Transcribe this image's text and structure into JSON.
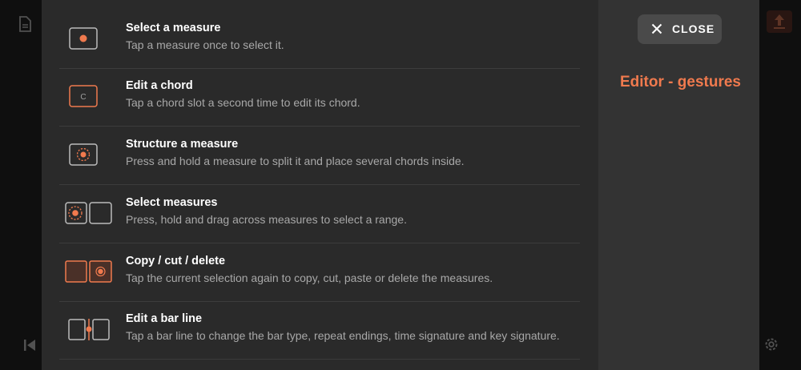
{
  "panel": {
    "title": "Editor - gestures",
    "close_label": "CLOSE"
  },
  "gestures": [
    {
      "icon": "select-measure-icon",
      "title": "Select a measure",
      "description": "Tap a measure once to select it."
    },
    {
      "icon": "edit-chord-icon",
      "title": "Edit a chord",
      "description": "Tap a chord slot a second time to edit its chord."
    },
    {
      "icon": "structure-measure-icon",
      "title": "Structure a measure",
      "description": "Press and hold a measure to split it and place several chords inside."
    },
    {
      "icon": "select-measures-icon",
      "title": "Select measures",
      "description": "Press, hold and drag across measures to select a range."
    },
    {
      "icon": "copy-cut-delete-icon",
      "title": "Copy / cut / delete",
      "description": "Tap the current selection again to copy, cut, paste or delete the measures."
    },
    {
      "icon": "edit-bar-line-icon",
      "title": "Edit a bar line",
      "description": "Tap a bar line to change the bar type, repeat endings, time signature and key signature."
    }
  ],
  "chord_glyph": "C",
  "colors": {
    "accent": "#f07a4e",
    "panel": "#2a2a2a",
    "sidebar": "#333333",
    "button": "#4a4a4a"
  }
}
